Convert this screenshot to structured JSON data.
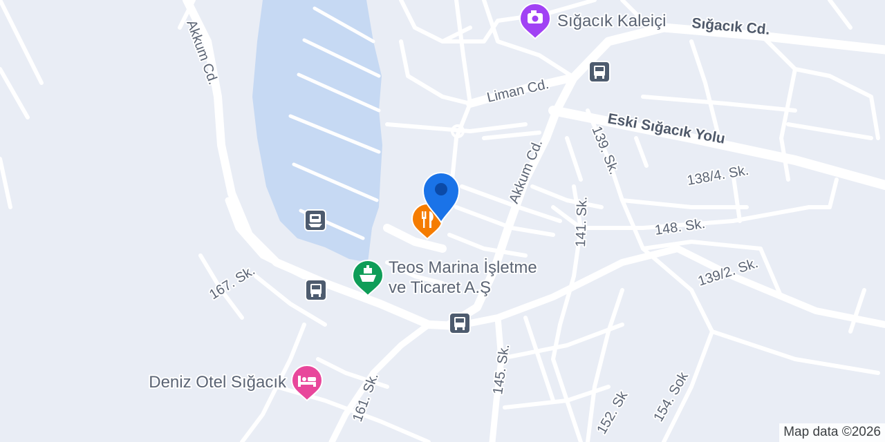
{
  "map": {
    "colors": {
      "land": "#e9edf5",
      "water": "#c6d9f3",
      "road": "#ffffff",
      "label": "#5b6474",
      "transit": "#4d5b6e",
      "restaurant": "#f57c00",
      "attraction": "#a142f4",
      "marina": "#0f9d58",
      "hotel": "#e8479b",
      "location_pin": "#1a73e8"
    },
    "streets": {
      "akkum_cd_west": "Akkum Cd.",
      "akkum_cd_east": "Akkum Cd.",
      "sigacik_cd": "Sığacık Cd.",
      "liman_cd": "Liman Cd.",
      "eski_sigacik_yolu": "Eski Sığacık Yolu",
      "sk_139": "139. Sk.",
      "sk_138_4": "138/4. Sk.",
      "sk_141": "141. Sk.",
      "sk_148": "148. Sk.",
      "sk_139_2": "139/2. Sk.",
      "sk_167": "167. Sk.",
      "sk_145": "145. Sk.",
      "sk_161": "161. Sk.",
      "sk_152": "152. Sk",
      "sok_154": "154. Sok"
    },
    "pois": {
      "kaleici": {
        "name": "Sığacık Kaleiçi",
        "icon": "camera-icon"
      },
      "marina_line1": "Teos Marina İşletme",
      "marina_line2": "ve Ticaret A.Ş",
      "marina_icon": "ship-icon",
      "hotel": {
        "name": "Deniz Otel Sığacık",
        "icon": "bed-icon"
      },
      "restaurant_icon": "fork-knife-icon",
      "transit_icon": "bus-icon"
    },
    "attribution": "Map data ©2026"
  }
}
